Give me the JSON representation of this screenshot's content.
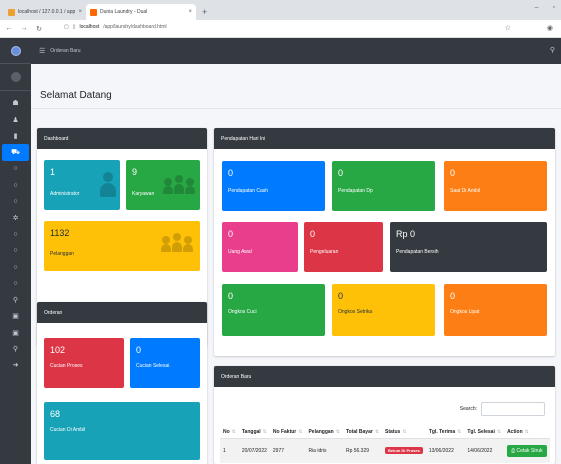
{
  "browser": {
    "tabs": [
      {
        "label": "localhost / 127.0.0.1 / app_laun",
        "active": false
      },
      {
        "label": "Dunia Laundry - Dual",
        "active": true
      }
    ],
    "new_tab": "+",
    "url_host": "localhost",
    "url_path": "/app/laundry/dashboard.html"
  },
  "topnav": {
    "label": "Orderan Baru"
  },
  "page": {
    "title": "Selamat Datang"
  },
  "dashboard": {
    "header": "Dashboard",
    "boxes": [
      {
        "value": "1",
        "label": "Administrator",
        "color": "#17a2b8"
      },
      {
        "value": "9",
        "label": "Karyawan",
        "color": "#28a745"
      },
      {
        "value": "1132",
        "label": "Pelanggan",
        "color": "#ffc107"
      }
    ]
  },
  "orderan": {
    "header": "Orderan",
    "boxes": [
      {
        "value": "102",
        "label": "Cucian Proses",
        "color": "#dc3545"
      },
      {
        "value": "0",
        "label": "Cucian Selesai",
        "color": "#007bff"
      },
      {
        "value": "68",
        "label": "Cucian Di Ambil",
        "color": "#17a2b8"
      }
    ]
  },
  "pendapatan": {
    "header": "Pendapatan Hari Ini",
    "boxes": [
      {
        "value": "0",
        "label": "Pendapatan Cash",
        "color": "#007bff"
      },
      {
        "value": "0",
        "label": "Pendapatan Dp",
        "color": "#28a745"
      },
      {
        "value": "0",
        "label": "Saat Di Ambil",
        "color": "#fd7e14"
      },
      {
        "value": "0",
        "label": "Uang Awal",
        "color": "#e83e8c"
      },
      {
        "value": "0",
        "label": "Pengeluaran",
        "color": "#dc3545"
      },
      {
        "value": "Rp 0",
        "label": "Pendapatan Bersih",
        "color": "#343a40"
      },
      {
        "value": "0",
        "label": "Ongkos Cuci",
        "color": "#28a745"
      },
      {
        "value": "0",
        "label": "Ongkos Setrika",
        "color": "#ffc107"
      },
      {
        "value": "0",
        "label": "Ongkos Lipat",
        "color": "#fd7e14"
      }
    ]
  },
  "orderan_baru": {
    "header": "Orderan Baru",
    "search_label": "Search:",
    "columns": [
      "No",
      "Tanggal",
      "No Faktur",
      "Pelanggan",
      "Total Bayar",
      "Status",
      "Tgl. Terima",
      "Tgl. Selesai",
      "Action"
    ],
    "rows": [
      {
        "no": "1",
        "tanggal": "20/07/2022",
        "faktur": "2977",
        "pelanggan": "Ria idris",
        "total": "Rp 56.329",
        "status": "Belum Di Proses",
        "terima": "13/06/2022",
        "selesai": "14/06/2022",
        "action": "Cetak Struk"
      }
    ]
  },
  "icons": {
    "sidebar": [
      "dashboard-icon",
      "user-icon",
      "book-icon",
      "cart-icon",
      "circle-icon",
      "circle-icon",
      "circle-icon",
      "gear-icon",
      "circle-icon",
      "circle-icon",
      "circle-icon",
      "circle-icon",
      "report-icon",
      "print-icon",
      "print-icon",
      "search-icon",
      "logout-icon"
    ]
  },
  "colors": {
    "sidebar": "#343a40",
    "accent": "#007bff"
  }
}
